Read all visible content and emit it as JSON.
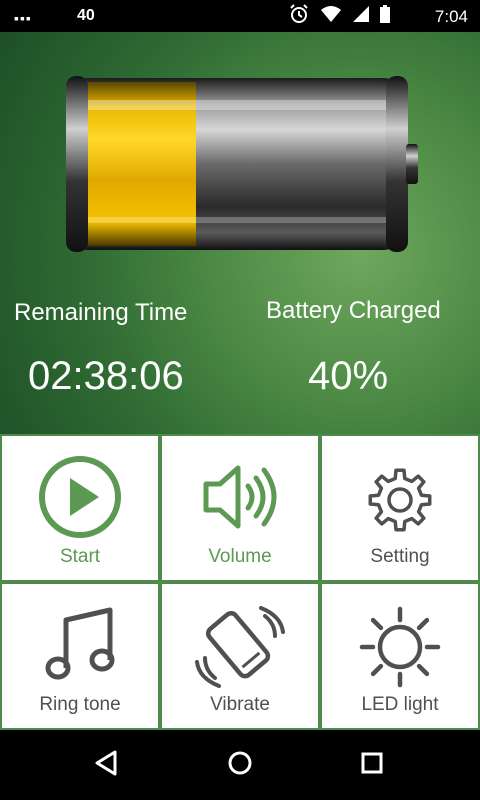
{
  "status_bar": {
    "dots": "▪▪▪",
    "notification_count": "40",
    "time": "7:04",
    "icons": [
      "alarm-icon",
      "wifi-icon",
      "signal-icon",
      "battery-icon"
    ]
  },
  "battery": {
    "charge_fraction": 0.4,
    "remaining_time_label": "Remaining Time",
    "remaining_time_value": "02:38:06",
    "charged_label": "Battery Charged",
    "charged_value": "40%"
  },
  "menu": [
    {
      "id": "start",
      "label": "Start",
      "icon": "play-icon"
    },
    {
      "id": "volume",
      "label": "Volume",
      "icon": "speaker-icon"
    },
    {
      "id": "setting",
      "label": "Setting",
      "icon": "gear-icon"
    },
    {
      "id": "ringtone",
      "label": "Ring tone",
      "icon": "music-note-icon"
    },
    {
      "id": "vibrate",
      "label": "Vibrate",
      "icon": "vibrate-phone-icon"
    },
    {
      "id": "led",
      "label": "LED  light",
      "icon": "sun-icon"
    }
  ],
  "colors": {
    "accent": "#5c9a54",
    "battery_fill": "#f2c20f",
    "hero_green": "#4c8a45"
  },
  "nav": [
    "back-icon",
    "home-icon",
    "recents-icon"
  ]
}
